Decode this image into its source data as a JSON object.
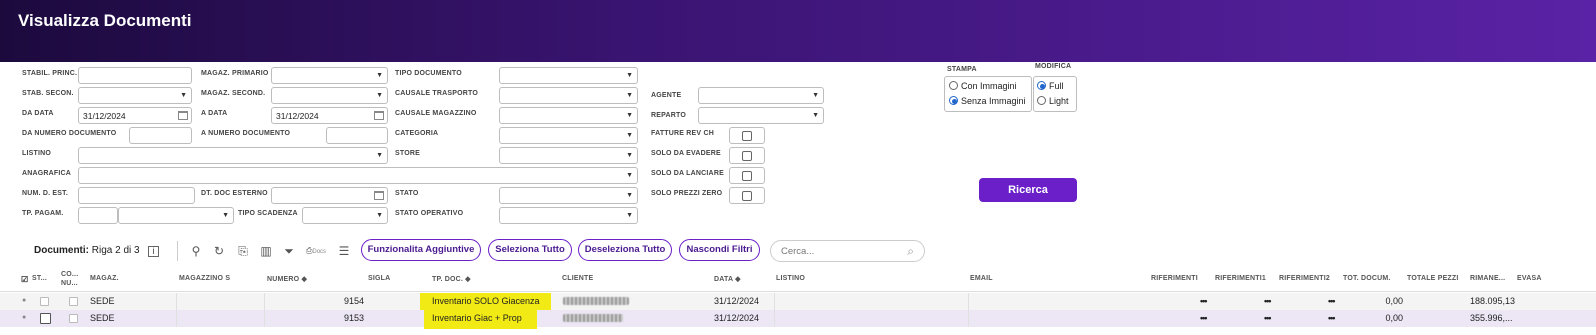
{
  "header": {
    "title": "Visualizza Documenti"
  },
  "filters": {
    "stabil_princ": {
      "label": "STABIL. PRINC.",
      "value": ""
    },
    "stab_secon": {
      "label": "STAB. SECON.",
      "value": ""
    },
    "da_data": {
      "label": "DA DATA",
      "value": "31/12/2024"
    },
    "da_numero_documento": {
      "label": "DA NUMERO DOCUMENTO",
      "value": ""
    },
    "listino": {
      "label": "LISTINO",
      "value": ""
    },
    "anagrafica": {
      "label": "ANAGRAFICA",
      "value": ""
    },
    "num_d_est": {
      "label": "NUM. D. EST.",
      "value": ""
    },
    "tp_pagam": {
      "label": "TP. PAGAM.",
      "value": ""
    },
    "magaz_primario": {
      "label": "MAGAZ. PRIMARIO",
      "value": ""
    },
    "magaz_second": {
      "label": "MAGAZ. SECOND.",
      "value": ""
    },
    "a_data": {
      "label": "A DATA",
      "value": "31/12/2024"
    },
    "a_numero_documento": {
      "label": "A NUMERO DOCUMENTO",
      "value": ""
    },
    "dt_doc_esterno": {
      "label": "DT. DOC ESTERNO",
      "value": ""
    },
    "tipo_scadenza": {
      "label": "TIPO SCADENZA",
      "value": ""
    },
    "tipo_documento": {
      "label": "TIPO DOCUMENTO",
      "value": ""
    },
    "causale_trasporto": {
      "label": "CAUSALE TRASPORTO",
      "value": ""
    },
    "causale_magazzino": {
      "label": "CAUSALE MAGAZZINO",
      "value": ""
    },
    "categoria": {
      "label": "CATEGORIA",
      "value": ""
    },
    "store": {
      "label": "STORE",
      "value": ""
    },
    "stato": {
      "label": "STATO",
      "value": ""
    },
    "stato_operativo": {
      "label": "STATO OPERATIVO",
      "value": ""
    },
    "agente": {
      "label": "AGENTE",
      "value": ""
    },
    "reparto": {
      "label": "REPARTO",
      "value": ""
    },
    "fatture_rev_ch": {
      "label": "FATTURE REV CH"
    },
    "solo_da_evadere": {
      "label": "SOLO DA EVADERE"
    },
    "solo_da_lanciare": {
      "label": "SOLO DA LANCIARE"
    },
    "solo_prezzi_zero": {
      "label": "SOLO PREZZI ZERO"
    },
    "stampa": {
      "label": "STAMPA",
      "options": [
        "Con Immagini",
        "Senza Immagini"
      ],
      "selected": "Senza Immagini"
    },
    "modifica": {
      "label": "MODIFICA",
      "options": [
        "Full",
        "Light"
      ],
      "selected": "Full"
    },
    "ricerca_label": "Ricerca"
  },
  "toolbar": {
    "documents_label": "Documenti:",
    "documents_range": "Riga 2 di 3",
    "docs_icon_label": "Docs",
    "funzionalita": "Funzionalita Aggiuntive",
    "seleziona_tutto": "Seleziona Tutto",
    "deseleziona_tutto": "Deseleziona Tutto",
    "nascondi_filtri": "Nascondi Filtri",
    "search_placeholder": "Cerca..."
  },
  "table": {
    "columns": {
      "st": "ST...",
      "co": "CO... NU...",
      "magaz": "MAGAZ.",
      "magazzino_s": "MAGAZZINO S",
      "numero": "NUMERO ◆",
      "sigla": "SIGLA",
      "tp_doc": "TP. DOC. ◆",
      "cliente": "CLIENTE",
      "data": "DATA ◆",
      "listino": "LISTINO",
      "email": "EMAIL",
      "riferimenti": "RIFERIMENTI",
      "riferimenti1": "RIFERIMENTI1",
      "riferimenti2": "RIFERIMENTI2",
      "tot_docum": "TOT. DOCUM.",
      "totale_pezzi": "TOTALE PEZZI",
      "rimane": "RIMANE...",
      "evasa": "EVASA"
    },
    "rows": [
      {
        "magaz": "SEDE",
        "sigla": "9154",
        "tp_doc": "Inventario SOLO Giacenza",
        "data": "31/12/2024",
        "riferimenti": "•••",
        "riferimenti1": "•••",
        "riferimenti2": "•••",
        "tot_docum": "0,00",
        "rimane": "188.095,13"
      },
      {
        "magaz": "SEDE",
        "sigla": "9153",
        "tp_doc": "Inventario Giac + Prop",
        "data": "31/12/2024",
        "riferimenti": "•••",
        "riferimenti1": "•••",
        "riferimenti2": "•••",
        "tot_docum": "0,00",
        "rimane": "355.996,..."
      }
    ]
  },
  "colors": {
    "accent": "#6a1fc9",
    "highlight": "#f2ea14",
    "header_dark": "#1c0a3d"
  }
}
